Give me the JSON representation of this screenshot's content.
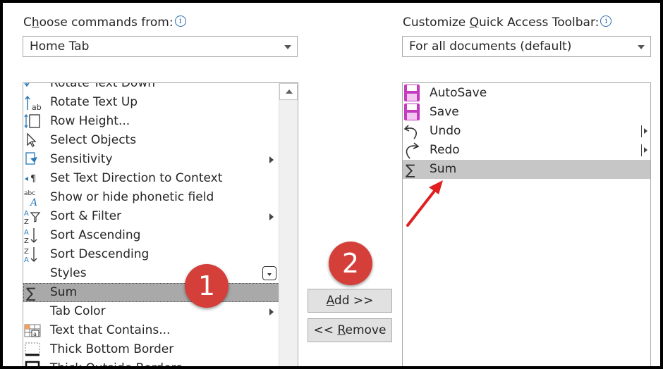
{
  "left": {
    "label_prefix": "C",
    "label_accel": "h",
    "label_suffix": "oose commands from:",
    "info": "i",
    "combo_value": "Home Tab",
    "items": [
      {
        "label": "Rotate Text Down",
        "icon": "rotate-text-down-icon",
        "submenu": false
      },
      {
        "label": "Rotate Text Up",
        "icon": "rotate-text-up-icon",
        "submenu": false
      },
      {
        "label": "Row Height...",
        "icon": "row-height-icon",
        "submenu": false
      },
      {
        "label": "Select Objects",
        "icon": "select-objects-icon",
        "submenu": false
      },
      {
        "label": "Sensitivity",
        "icon": "sensitivity-icon",
        "submenu": true
      },
      {
        "label": "Set Text Direction to Context",
        "icon": "text-direction-icon",
        "submenu": false
      },
      {
        "label": "Show or hide phonetic field",
        "icon": "phonetic-field-icon",
        "submenu": false
      },
      {
        "label": "Sort & Filter",
        "icon": "sort-filter-icon",
        "submenu": true
      },
      {
        "label": "Sort Ascending",
        "icon": "sort-ascending-icon",
        "submenu": false
      },
      {
        "label": "Sort Descending",
        "icon": "sort-descending-icon",
        "submenu": false
      },
      {
        "label": "Styles",
        "icon": "styles-icon",
        "submenu": false
      },
      {
        "label": "Sum",
        "icon": "sum-icon",
        "submenu": false,
        "selected": true
      },
      {
        "label": "Tab Color",
        "icon": "tab-color-icon",
        "submenu": true
      },
      {
        "label": "Text that Contains...",
        "icon": "text-contains-icon",
        "submenu": false
      },
      {
        "label": "Thick Bottom Border",
        "icon": "thick-bottom-border-icon",
        "submenu": false
      },
      {
        "label": "Thick Outside Borders",
        "icon": "thick-outside-borders-icon",
        "submenu": false
      }
    ]
  },
  "right": {
    "label_prefix": "Customize ",
    "label_accel": "Q",
    "label_suffix": "uick Access Toolbar:",
    "info": "i",
    "combo_value": "For all documents (default)",
    "items": [
      {
        "label": "AutoSave",
        "icon": "save-icon",
        "submenu": false
      },
      {
        "label": "Save",
        "icon": "save-icon",
        "submenu": false
      },
      {
        "label": "Undo",
        "icon": "undo-icon",
        "submenu": true
      },
      {
        "label": "Redo",
        "icon": "redo-icon",
        "submenu": true
      },
      {
        "label": "Sum",
        "icon": "sum-icon",
        "submenu": false,
        "selected": true
      }
    ]
  },
  "buttons": {
    "add_accel": "A",
    "add_rest": "dd >>",
    "remove_prefix": "<< ",
    "remove_accel": "R",
    "remove_rest": "emove"
  },
  "annotations": {
    "badge1": "1",
    "badge2": "2",
    "accent_color": "#d43f3a",
    "arrow_color": "#e02020"
  }
}
